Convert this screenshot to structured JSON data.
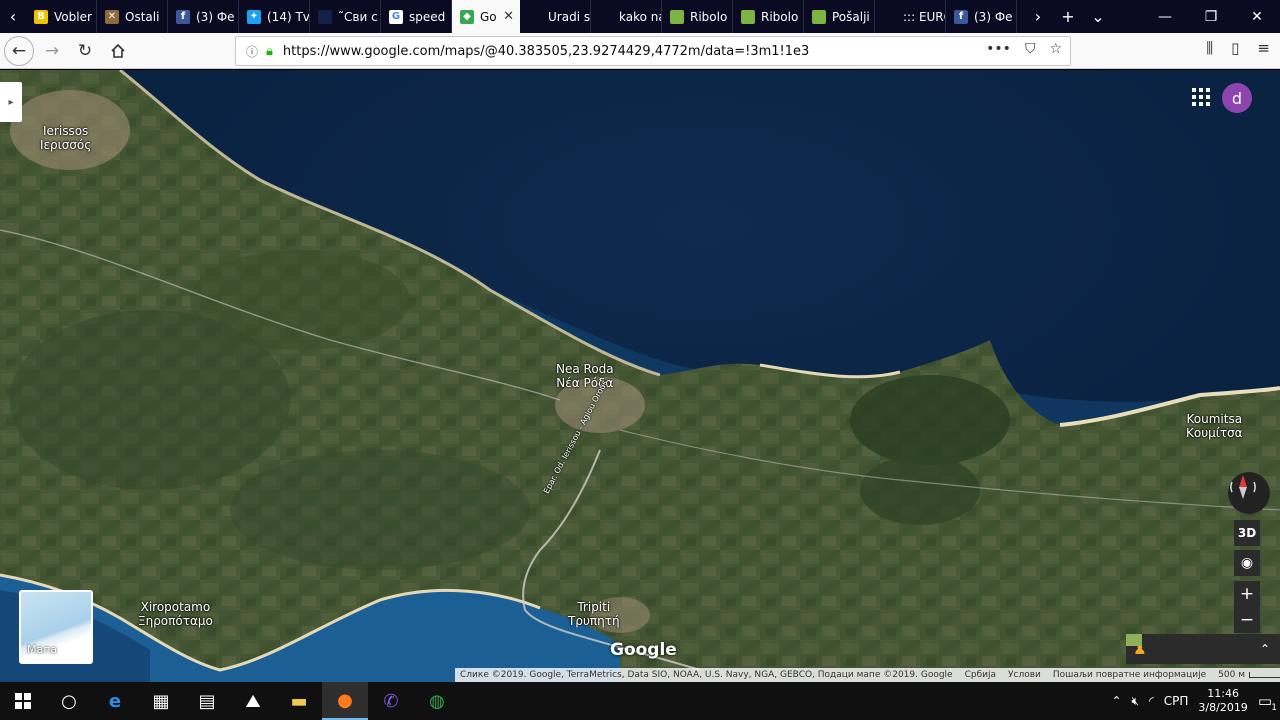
{
  "browser": {
    "tabs": [
      {
        "label": "Vobler",
        "icon": "b-favicon",
        "color": "#f2c200",
        "glyph": "B"
      },
      {
        "label": "Ostali",
        "icon": "fish-favicon",
        "color": "#8a6d3b",
        "glyph": "✕"
      },
      {
        "label": "(3) Фе",
        "icon": "facebook-favicon",
        "color": "#3b5998",
        "glyph": "f"
      },
      {
        "label": "(14) Tv",
        "icon": "twitter-favicon",
        "color": "#1da1f2",
        "glyph": "✦"
      },
      {
        "label": "˜Сви с",
        "icon": "site-favicon",
        "color": "#15204a",
        "glyph": ""
      },
      {
        "label": "speed",
        "icon": "google-favicon",
        "color": "#ffffff",
        "glyph": "G"
      },
      {
        "label": "Go",
        "icon": "google-maps-favicon",
        "color": "#34a853",
        "glyph": "◆",
        "active": true
      },
      {
        "label": "Uradi sam",
        "icon": "none",
        "color": "#0a0a23",
        "glyph": ""
      },
      {
        "label": "kako napr",
        "icon": "none",
        "color": "#0a0a23",
        "glyph": ""
      },
      {
        "label": "Ribolo",
        "icon": "green-favicon",
        "color": "#7cb342",
        "glyph": ""
      },
      {
        "label": "Ribolo",
        "icon": "green-favicon",
        "color": "#7cb342",
        "glyph": ""
      },
      {
        "label": "Pošalji",
        "icon": "green-favicon",
        "color": "#7cb342",
        "glyph": ""
      },
      {
        "label": "::: EUROST",
        "icon": "none",
        "color": "#0a0a23",
        "glyph": ""
      },
      {
        "label": "(3) Фе",
        "icon": "facebook-favicon",
        "color": "#3b5998",
        "glyph": "f"
      }
    ],
    "tab_close": "✕",
    "new_tab": "+",
    "tab_list": "⌄",
    "url": "https://www.google.com/maps/@40.383505,23.9274429,4772m/data=!3m1!1e3",
    "url_host_prefix": "https://www.",
    "window": {
      "min": "—",
      "max": "❐",
      "close": "✕"
    }
  },
  "map": {
    "places": [
      {
        "name_latin": "Ierissos",
        "name_greek": "Ιερισσός"
      },
      {
        "name_latin": "Nea Roda",
        "name_greek": "Νέα Ρόδα"
      },
      {
        "name_latin": "Koumitsa",
        "name_greek": "Κουμίτσα"
      },
      {
        "name_latin": "Xiropotamo",
        "name_greek": "Ξηροπόταμο"
      },
      {
        "name_latin": "Tripiti",
        "name_greek": "Τρυπητή"
      }
    ],
    "road_label": "Epar. Od. Ierissou - Agiou Orous",
    "account_initial": "d",
    "three_d_label": "3D",
    "zoom_in": "+",
    "zoom_out": "−",
    "minimap_label": "Мапа",
    "google_logo": "Google",
    "attribution": "Слике ©2019. Google, TerraMetrics, Data SIO, NOAA, U.S. Navy, NGA, GEBCO, Подаци мапе ©2019. Google",
    "region": "Србија",
    "terms": "Услови",
    "feedback": "Пошаљи повратне информације",
    "scale": "500 м"
  },
  "taskbar": {
    "language": "СРП",
    "time": "11:46",
    "date": "3/8/2019",
    "notifications": "1"
  }
}
